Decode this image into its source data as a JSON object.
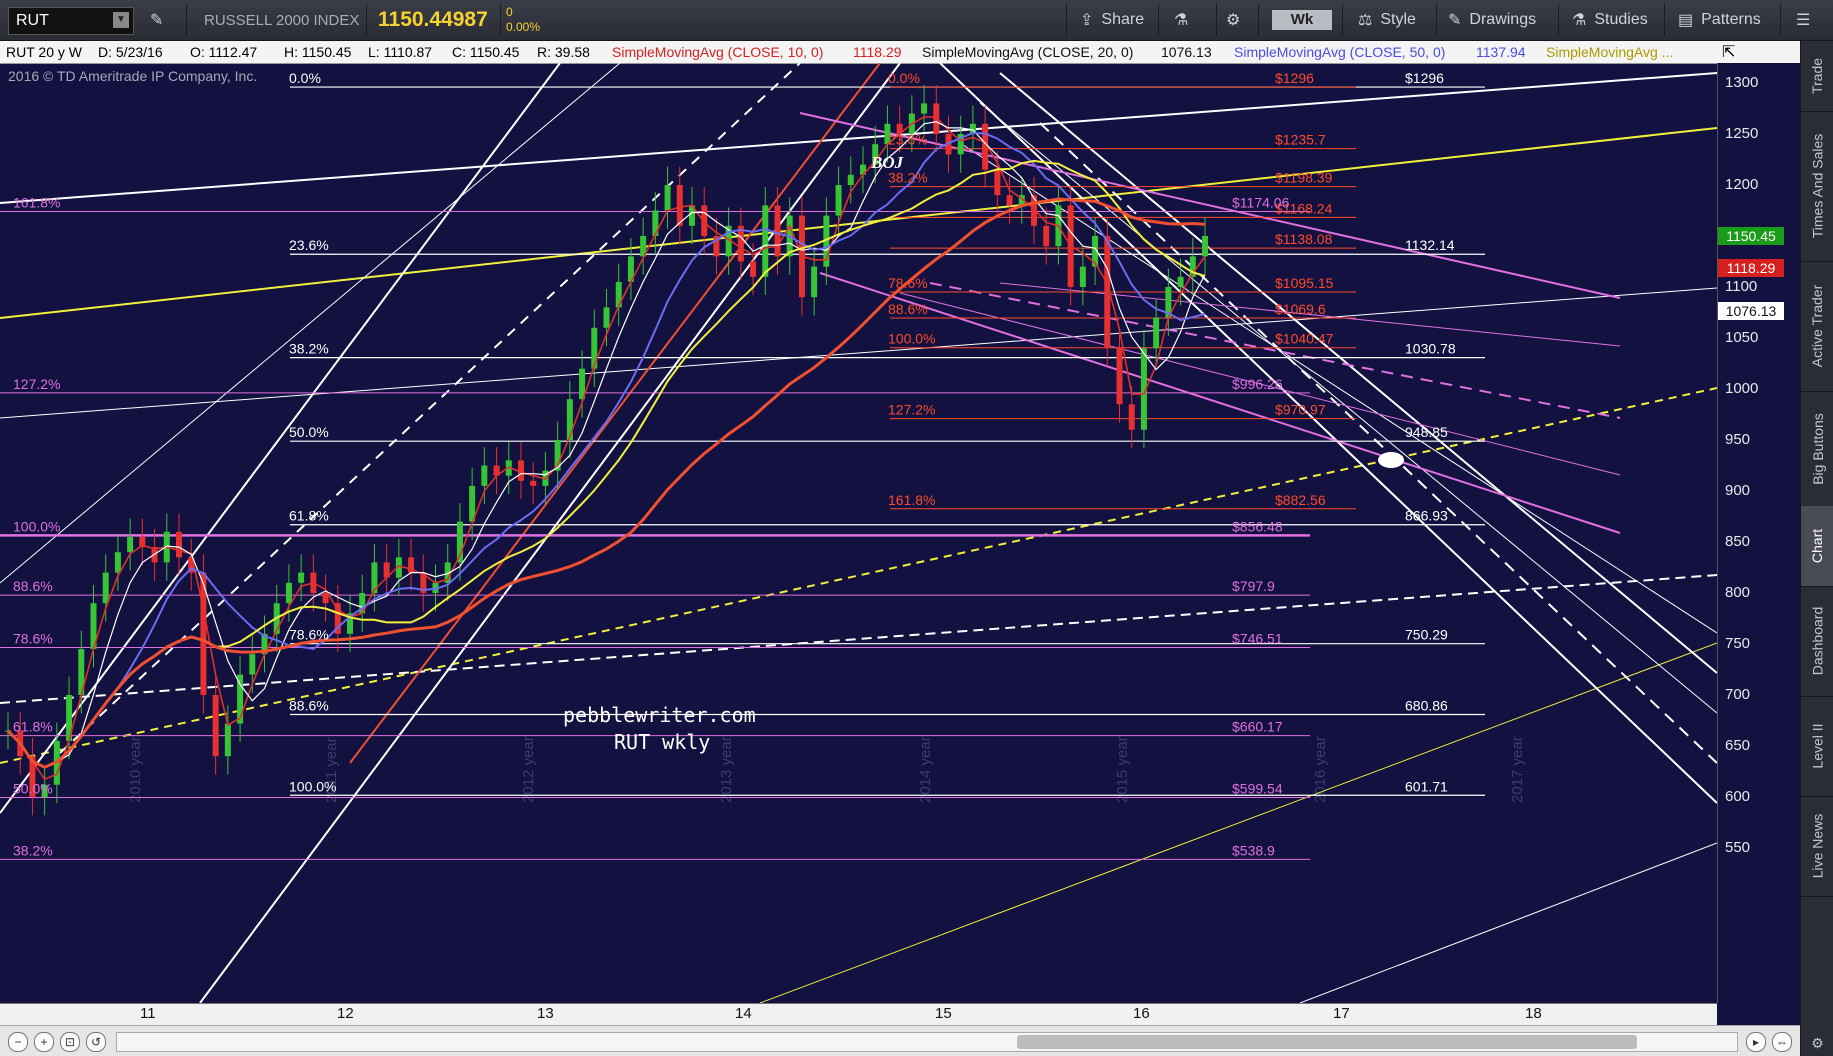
{
  "toolbar": {
    "symbol": "RUT",
    "index_name": "RUSSELL 2000 INDEX",
    "last_price": "1150.44987",
    "change_abs": "0",
    "change_pct": "0.00%",
    "share": "Share",
    "interval": "Wk",
    "style": "Style",
    "drawings": "Drawings",
    "studies": "Studies",
    "patterns": "Patterns"
  },
  "legend": {
    "desc": "RUT 20 y W",
    "date": "D: 5/23/16",
    "open": "O: 1112.47",
    "high": "H: 1150.45",
    "low": "L: 1110.87",
    "close": "C: 1150.45",
    "range": "R: 39.58",
    "sma10_label": "SimpleMovingAvg (CLOSE, 10, 0)",
    "sma10_val": "1118.29",
    "sma20_label": "SimpleMovingAvg (CLOSE, 20, 0)",
    "sma20_val": "1076.13",
    "sma50_label": "SimpleMovingAvg (CLOSE, 50, 0)",
    "sma50_val": "1137.94",
    "sma_more": "SimpleMovingAvg ..."
  },
  "copyright": "2016 © TD Ameritrade IP Company, Inc.",
  "watermark": {
    "line1": "pebblewriter.com",
    "line2": "RUT wkly"
  },
  "annotation_boj": "BOJ",
  "colors": {
    "bg": "#12113f",
    "price_badge": "#1a9c1a",
    "sma10": "#e0302a",
    "sma20": "#ffffff",
    "sma50": "#6b6cf2",
    "sma_yellow": "#f0f03c",
    "fib_magenta": "#e070e0",
    "fib_red": "#ff4a2a"
  },
  "chart_data": {
    "type": "candlestick",
    "yaxis": {
      "ylim": [
        540,
        1330
      ],
      "ticks": [
        550,
        600,
        650,
        700,
        750,
        800,
        850,
        900,
        950,
        1000,
        1050,
        1100,
        1150,
        1200,
        1250,
        1300
      ]
    },
    "xaxis": {
      "ticks": [
        "11",
        "12",
        "13",
        "14",
        "15",
        "16",
        "17",
        "18"
      ],
      "year_watermarks": [
        "2010 year",
        "2011 year",
        "2012 year",
        "2013 year",
        "2014 year",
        "2015 year",
        "2016 year",
        "2017 year"
      ]
    },
    "price_badges": [
      {
        "value": "1150.45",
        "color": "#1a9c1a"
      },
      {
        "value": "1118.29",
        "color": "#d62020"
      },
      {
        "value": "1076.13",
        "color": "#ffffff"
      }
    ],
    "white_levels": [
      {
        "label": "$1296",
        "value": 1296
      },
      {
        "label": "1132.14",
        "value": 1132.14
      },
      {
        "label": "1030.78",
        "value": 1030.78
      },
      {
        "label": "948.85",
        "value": 948.85
      },
      {
        "label": "866.93",
        "value": 866.93
      },
      {
        "label": "750.29",
        "value": 750.29
      },
      {
        "label": "680.86",
        "value": 680.86
      },
      {
        "label": "601.71",
        "value": 601.71
      }
    ],
    "red_levels": [
      {
        "label": "$1296",
        "value": 1296
      },
      {
        "label": "$1235.7",
        "value": 1235.7
      },
      {
        "label": "$1198.39",
        "value": 1198.39
      },
      {
        "label": "$1168.24",
        "value": 1168.24
      },
      {
        "label": "$1138.08",
        "value": 1138.08
      },
      {
        "label": "$1095.15",
        "value": 1095.15
      },
      {
        "label": "$1069.6",
        "value": 1069.6
      },
      {
        "label": "$1040.47",
        "value": 1040.47
      },
      {
        "label": "$970.97",
        "value": 970.97
      },
      {
        "label": "$882.56",
        "value": 882.56
      }
    ],
    "magenta_levels": [
      {
        "label": "$1174.06",
        "value": 1174.06
      },
      {
        "label": "$996.26",
        "value": 996.26
      },
      {
        "label": "$856.48",
        "value": 856.48
      },
      {
        "label": "$797.9",
        "value": 797.9
      },
      {
        "label": "$746.51",
        "value": 746.51
      },
      {
        "label": "$660.17",
        "value": 660.17
      },
      {
        "label": "$599.54",
        "value": 599.54
      },
      {
        "label": "$538.9",
        "value": 538.9
      }
    ],
    "fib_white": [
      {
        "label": "0.0%",
        "value": 1296
      },
      {
        "label": "23.6%",
        "value": 1132.14
      },
      {
        "label": "38.2%",
        "value": 1030.78
      },
      {
        "label": "50.0%",
        "value": 948.85
      },
      {
        "label": "61.8%",
        "value": 866.93
      },
      {
        "label": "78.6%",
        "value": 750.29
      },
      {
        "label": "88.6%",
        "value": 680.86
      },
      {
        "label": "100.0%",
        "value": 601.71
      }
    ],
    "fib_red": [
      {
        "label": "0.0%",
        "value": 1296
      },
      {
        "label": "23.6%",
        "value": 1235.7
      },
      {
        "label": "38.2%",
        "value": 1198.39
      },
      {
        "label": "78.6%",
        "value": 1095.15
      },
      {
        "label": "88.6%",
        "value": 1069.6
      },
      {
        "label": "100.0%",
        "value": 1040.47
      },
      {
        "label": "127.2%",
        "value": 970.97
      },
      {
        "label": "161.8%",
        "value": 882.56
      }
    ],
    "fib_magenta": [
      {
        "label": "161.8%",
        "value": 1174.06
      },
      {
        "label": "127.2%",
        "value": 996.26
      },
      {
        "label": "100.0%",
        "value": 856.48
      },
      {
        "label": "88.6%",
        "value": 797.9
      },
      {
        "label": "78.6%",
        "value": 746.51
      },
      {
        "label": "61.8%",
        "value": 660.17
      },
      {
        "label": "50.0%",
        "value": 599.54
      },
      {
        "label": "38.2%",
        "value": 538.9
      }
    ],
    "close_series": [
      665,
      640,
      600,
      612,
      655,
      700,
      745,
      790,
      820,
      840,
      855,
      845,
      830,
      860,
      835,
      820,
      700,
      640,
      672,
      720,
      740,
      760,
      790,
      810,
      820,
      800,
      790,
      760,
      780,
      800,
      830,
      815,
      835,
      820,
      800,
      810,
      830,
      870,
      905,
      925,
      915,
      930,
      910,
      905,
      920,
      950,
      990,
      1020,
      1060,
      1080,
      1105,
      1130,
      1150,
      1175,
      1200,
      1160,
      1180,
      1150,
      1130,
      1160,
      1125,
      1110,
      1180,
      1130,
      1170,
      1090,
      1120,
      1170,
      1200,
      1210,
      1220,
      1240,
      1260,
      1250,
      1270,
      1280,
      1250,
      1230,
      1250,
      1260,
      1215,
      1190,
      1180,
      1190,
      1160,
      1140,
      1180,
      1100,
      1120,
      1150,
      1040,
      985,
      960,
      1040,
      1070,
      1100,
      1110,
      1130,
      1150
    ],
    "series": [
      {
        "name": "SimpleMovingAvg (CLOSE, 10, 0)",
        "last": 1118.29
      },
      {
        "name": "SimpleMovingAvg (CLOSE, 20, 0)",
        "last": 1076.13
      },
      {
        "name": "SimpleMovingAvg (CLOSE, 50, 0)",
        "last": 1137.94
      }
    ]
  },
  "sidebar": [
    "Trade",
    "Times And Sales",
    "Active Trader",
    "Big Buttons",
    "Chart",
    "Dashboard",
    "Level II",
    "Live News"
  ]
}
